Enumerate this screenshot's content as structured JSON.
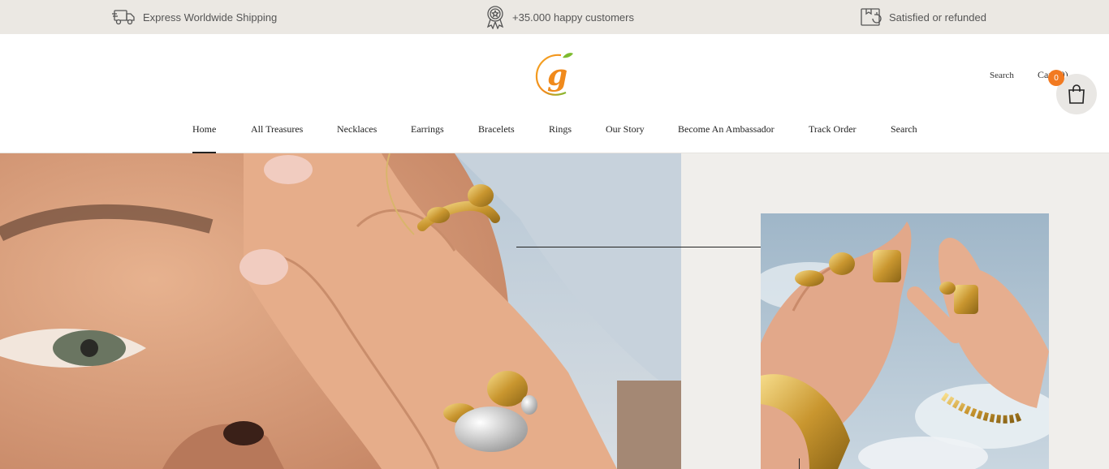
{
  "topbar": {
    "perks": [
      {
        "icon": "delivery-truck-icon",
        "label": "Express Worldwide Shipping"
      },
      {
        "icon": "award-badge-icon",
        "label": "+35.000 happy customers"
      },
      {
        "icon": "refund-box-icon",
        "label": "Satisfied or refunded"
      }
    ]
  },
  "header": {
    "logo_letter": "g",
    "search_label": "Search",
    "cart_label": "Cart (0)",
    "cart_count": "0"
  },
  "nav": {
    "items": [
      {
        "label": "Home",
        "active": true
      },
      {
        "label": "All Treasures"
      },
      {
        "label": "Necklaces"
      },
      {
        "label": "Earrings"
      },
      {
        "label": "Bracelets"
      },
      {
        "label": "Rings"
      },
      {
        "label": "Our Story"
      },
      {
        "label": "Become An Ambassador"
      },
      {
        "label": "Track Order"
      },
      {
        "label": "Search"
      }
    ]
  },
  "colors": {
    "topbar_bg": "#ebe8e3",
    "badge": "#f27a21",
    "logo_orange": "#f08a1c",
    "logo_green": "#7dbb2f",
    "hero_bg": "#f0eeeb"
  }
}
